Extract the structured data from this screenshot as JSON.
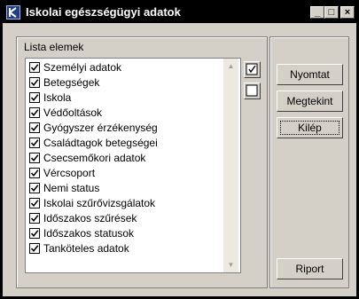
{
  "window": {
    "title": "Iskolai egészségügyi adatok",
    "icon": "app-logo-icon",
    "controls": [
      "minimize-icon",
      "maximize-icon",
      "close-icon"
    ]
  },
  "list": {
    "title": "Lista elemek",
    "items": [
      {
        "label": "Személyi adatok",
        "checked": true
      },
      {
        "label": "Betegségek",
        "checked": true
      },
      {
        "label": "Iskola",
        "checked": true
      },
      {
        "label": "Védőoltások",
        "checked": true
      },
      {
        "label": "Gyógyszer érzékenység",
        "checked": true
      },
      {
        "label": "Családtagok betegségei",
        "checked": true
      },
      {
        "label": "Csecsemőkori adatok",
        "checked": true
      },
      {
        "label": "Vércsoport",
        "checked": true
      },
      {
        "label": "Nemi status",
        "checked": true
      },
      {
        "label": "Iskolai szűrővizsgálatok",
        "checked": true
      },
      {
        "label": "Időszakos szűrések",
        "checked": true
      },
      {
        "label": "Időszakos statusok",
        "checked": true
      },
      {
        "label": "Tanköteles adatok",
        "checked": true
      }
    ]
  },
  "buttons": {
    "print": "Nyomtat",
    "view": "Megtekint",
    "exit": "Kilép",
    "report": "Riport"
  }
}
